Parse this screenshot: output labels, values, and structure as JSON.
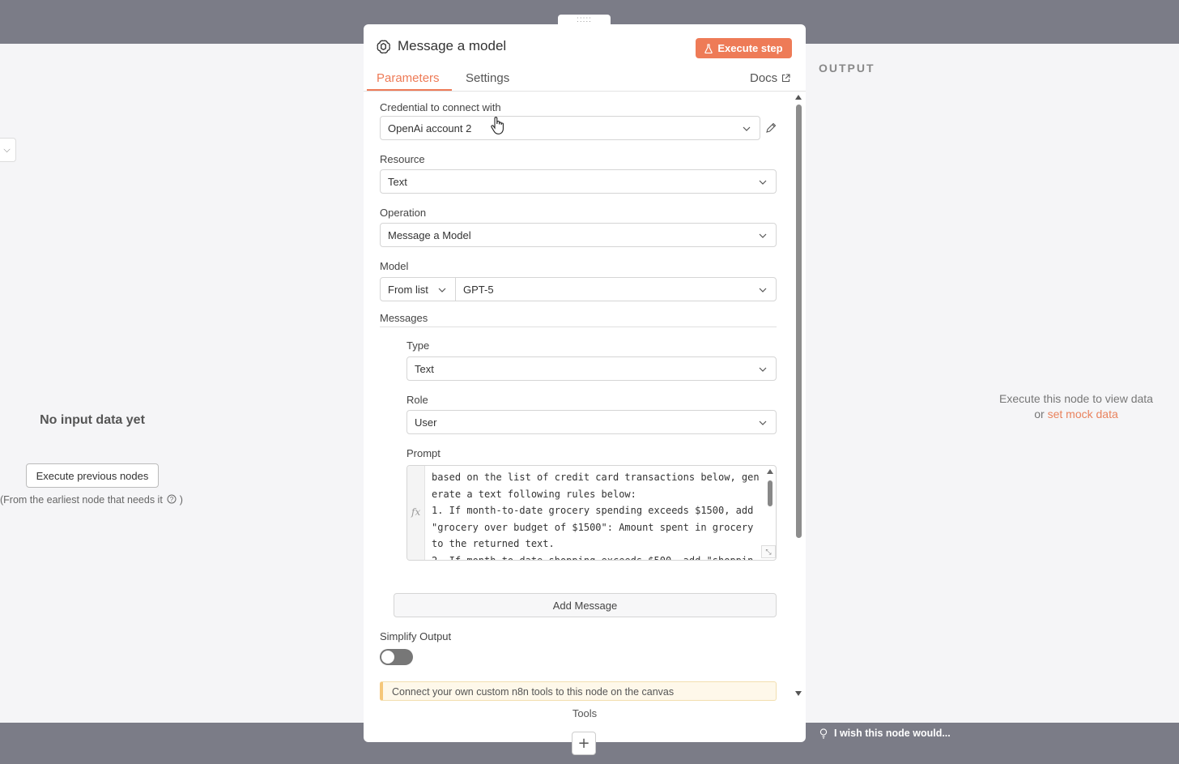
{
  "panel": {
    "title": "Message a model",
    "execute_step_label": "Execute step",
    "tabs": [
      {
        "label": "Parameters",
        "active": true
      },
      {
        "label": "Settings",
        "active": false
      }
    ],
    "docs_label": "Docs",
    "accent_color": "#ee7b57"
  },
  "fields": {
    "credential": {
      "label": "Credential to connect with",
      "value": "OpenAi account 2"
    },
    "resource": {
      "label": "Resource",
      "value": "Text"
    },
    "operation": {
      "label": "Operation",
      "value": "Message a Model"
    },
    "model": {
      "label": "Model",
      "mode": "From list",
      "value": "GPT-5"
    },
    "messages_label": "Messages",
    "type": {
      "label": "Type",
      "value": "Text"
    },
    "role": {
      "label": "Role",
      "value": "User"
    },
    "prompt": {
      "label": "Prompt",
      "fx": "fx",
      "value": "based on the list of credit card transactions below, generate a text following rules below:\n1. If month-to-date grocery spending exceeds $1500, add \"grocery over budget of $1500\": Amount spent in grocery to the returned text.\n2. If month-to-date shopping exceeds $500, add \"shoppin"
    },
    "add_message_label": "Add Message",
    "simplify_output": {
      "label": "Simplify Output",
      "enabled": false
    },
    "tools_notice": "Connect your own custom n8n tools to this node on the canvas",
    "tools_label": "Tools"
  },
  "input_pane": {
    "no_input": "No input data yet",
    "execute_previous": "Execute previous nodes",
    "earliest_note": "(From the earliest node that needs it",
    "earliest_close": ")"
  },
  "output_pane": {
    "title": "OUTPUT",
    "hint_line1": "Execute this node to view data",
    "hint_or": "or",
    "mock_link": "set mock data"
  },
  "footer": {
    "wish": "I wish this node would...",
    "plus": "+"
  },
  "drag_handle": ":::::"
}
